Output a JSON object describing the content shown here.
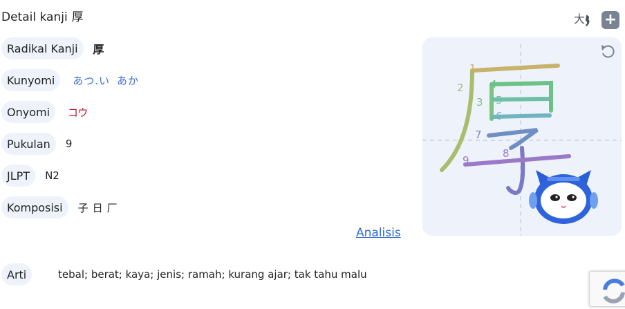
{
  "header": {
    "title": "Detail kanji",
    "kanji": "厚"
  },
  "toolbar": {
    "size_icon_glyph": "大",
    "add_icon_glyph": "+"
  },
  "details": {
    "radikal": {
      "label": "Radikal Kanji",
      "value": "厚"
    },
    "kunyomi": {
      "label": "Kunyomi",
      "values": [
        "あつ.い",
        "あか"
      ]
    },
    "onyomi": {
      "label": "Onyomi",
      "value": "コウ"
    },
    "pukulan": {
      "label": "Pukulan",
      "value": "9"
    },
    "jlpt": {
      "label": "JLPT",
      "value": "N2"
    },
    "komposisi": {
      "label": "Komposisi",
      "values": [
        "子",
        "日",
        "厂"
      ]
    }
  },
  "analysis_link": "Analisis",
  "arti": {
    "label": "Arti",
    "value": "tebal; berat; kaya; jenis; ramah; kurang ajar; tak tahu malu"
  },
  "stroke_numbers": [
    "1",
    "2",
    "3",
    "4",
    "5",
    "6",
    "7",
    "8",
    "9"
  ],
  "colors": {
    "kana": "#3b6fd4",
    "onyomi": "#c0162b",
    "link": "#2f6bd6",
    "pill_bg": "#eef3fb",
    "panel_bg": "#eef2fb"
  }
}
